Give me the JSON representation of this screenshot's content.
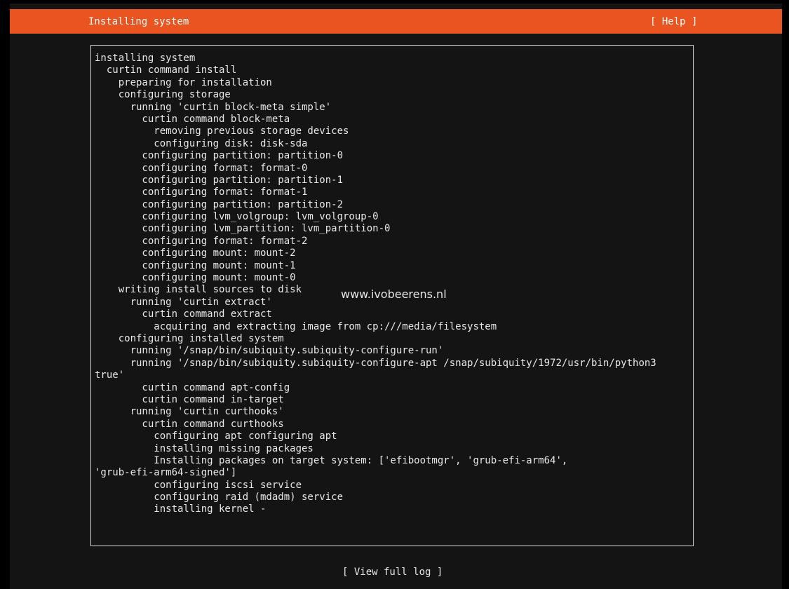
{
  "colors": {
    "header_bg": "#e95420",
    "screen_bg": "#141414",
    "text": "#e8e8e8"
  },
  "header": {
    "title": "Installing system",
    "help_label": "[ Help ]"
  },
  "log": {
    "lines": [
      "installing system",
      "  curtin command install",
      "    preparing for installation",
      "    configuring storage",
      "      running 'curtin block-meta simple'",
      "        curtin command block-meta",
      "          removing previous storage devices",
      "          configuring disk: disk-sda",
      "        configuring partition: partition-0",
      "        configuring format: format-0",
      "        configuring partition: partition-1",
      "        configuring format: format-1",
      "        configuring partition: partition-2",
      "        configuring lvm_volgroup: lvm_volgroup-0",
      "        configuring lvm_partition: lvm_partition-0",
      "        configuring format: format-2",
      "        configuring mount: mount-2",
      "        configuring mount: mount-1",
      "        configuring mount: mount-0",
      "    writing install sources to disk",
      "      running 'curtin extract'",
      "        curtin command extract",
      "          acquiring and extracting image from cp:///media/filesystem",
      "    configuring installed system",
      "      running '/snap/bin/subiquity.subiquity-configure-run'",
      "      running '/snap/bin/subiquity.subiquity-configure-apt /snap/subiquity/1972/usr/bin/python3",
      "true'",
      "        curtin command apt-config",
      "        curtin command in-target",
      "      running 'curtin curthooks'",
      "        curtin command curthooks",
      "          configuring apt configuring apt",
      "          installing missing packages",
      "          Installing packages on target system: ['efibootmgr', 'grub-efi-arm64',",
      "'grub-efi-arm64-signed']",
      "          configuring iscsi service",
      "          configuring raid (mdadm) service",
      "          installing kernel -"
    ]
  },
  "watermark": "www.ivobeerens.nl",
  "footer": {
    "view_log_label": "[ View full log ]"
  }
}
